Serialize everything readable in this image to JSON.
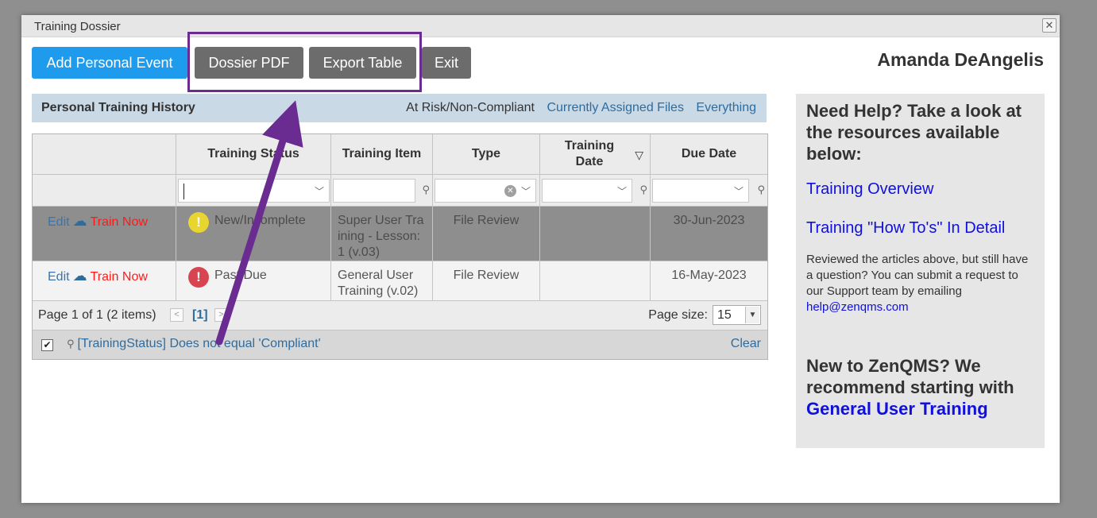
{
  "dialog": {
    "title": "Training Dossier",
    "close_glyph": "✕"
  },
  "toolbar": {
    "add_event": "Add Personal Event",
    "dossier_pdf": "Dossier PDF",
    "export_table": "Export Table",
    "exit": "Exit"
  },
  "user": {
    "name": "Amanda DeAngelis"
  },
  "history": {
    "title": "Personal Training History",
    "links": [
      "At Risk/Non-Compliant",
      "Currently Assigned Files",
      "Everything"
    ]
  },
  "table": {
    "columns": [
      "",
      "Training Status",
      "Training Item",
      "Type",
      "Training Date",
      "Due Date"
    ],
    "rows": [
      {
        "edit": "Edit",
        "train": "Train Now",
        "status": "New/Incomplete",
        "item": "Super User Training - Lesson:1 (v.03)",
        "type": "File Review",
        "training_date": "",
        "due": "30-Jun-2023"
      },
      {
        "edit": "Edit",
        "train": "Train Now",
        "status": "Past Due",
        "item": "General User Training (v.02)",
        "type": "File Review",
        "training_date": "",
        "due": "16-May-2023"
      }
    ]
  },
  "pager": {
    "summary": "Page 1 of 1 (2 items)",
    "current": "[1]",
    "page_size_label": "Page size:",
    "page_size": "15"
  },
  "filter": {
    "expression": "[TrainingStatus] Does not equal 'Compliant'",
    "clear": "Clear"
  },
  "help": {
    "heading": "Need Help? Take a look at the resources available below:",
    "link1": "Training Overview",
    "link2": "Training \"How To's\" In Detail",
    "note": "Reviewed the articles above, but still have a question? You can submit a request to our Support team by emailing ",
    "email": "help@zenqms.com",
    "new_prefix": "New to ZenQMS? We recommend starting with ",
    "new_link": "General User Training"
  },
  "colors": {
    "primary": "#1f9bed",
    "button_gray": "#6c6c6c",
    "annotation": "#6a2c91",
    "link": "#2f6c9e",
    "danger": "#ff1a1a"
  }
}
